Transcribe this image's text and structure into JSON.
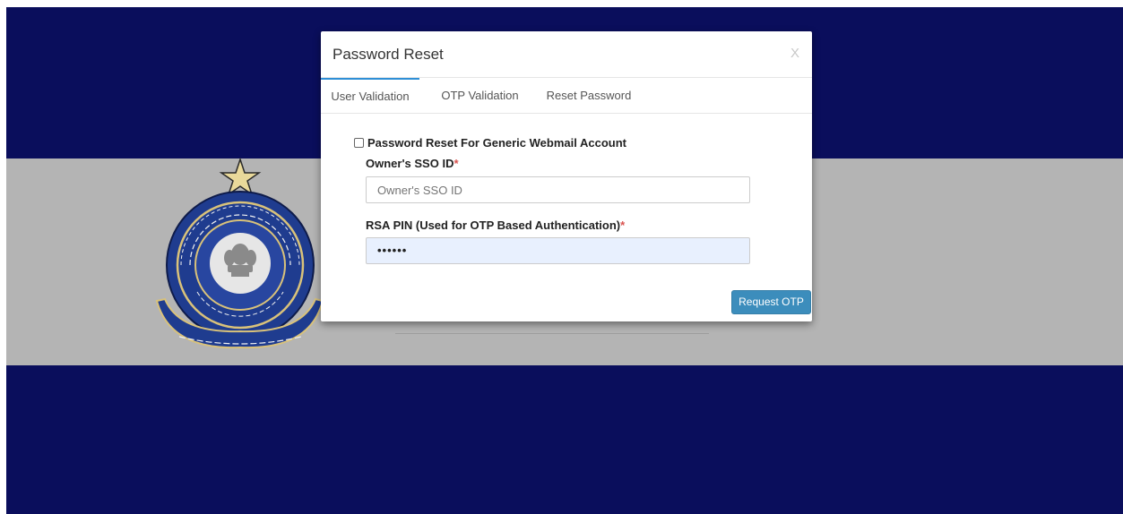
{
  "modal": {
    "title": "Password Reset",
    "close_label": "X"
  },
  "tabs": [
    {
      "label": "User Validation",
      "active": true
    },
    {
      "label": "OTP Validation",
      "active": false
    },
    {
      "label": "Reset Password",
      "active": false
    }
  ],
  "form": {
    "generic_checkbox_label": "Password Reset For Generic Webmail Account",
    "generic_checkbox_checked": false,
    "sso_label": "Owner's SSO ID",
    "sso_placeholder": "Owner's SSO ID",
    "sso_value": "",
    "rsa_label": "RSA PIN (Used for OTP Based Authentication)",
    "rsa_value": "••••••",
    "required_mark": "*",
    "request_otp_label": "Request OTP"
  },
  "colors": {
    "band_dark": "#0a0e5c",
    "band_gray": "#b4b4b4",
    "accent": "#3c8dbc",
    "tab_active_border": "#2f8fd6",
    "required": "#d9534f"
  },
  "icons": {
    "emblem": "cbic-emblem-icon",
    "checkbox": "checkbox-icon"
  }
}
